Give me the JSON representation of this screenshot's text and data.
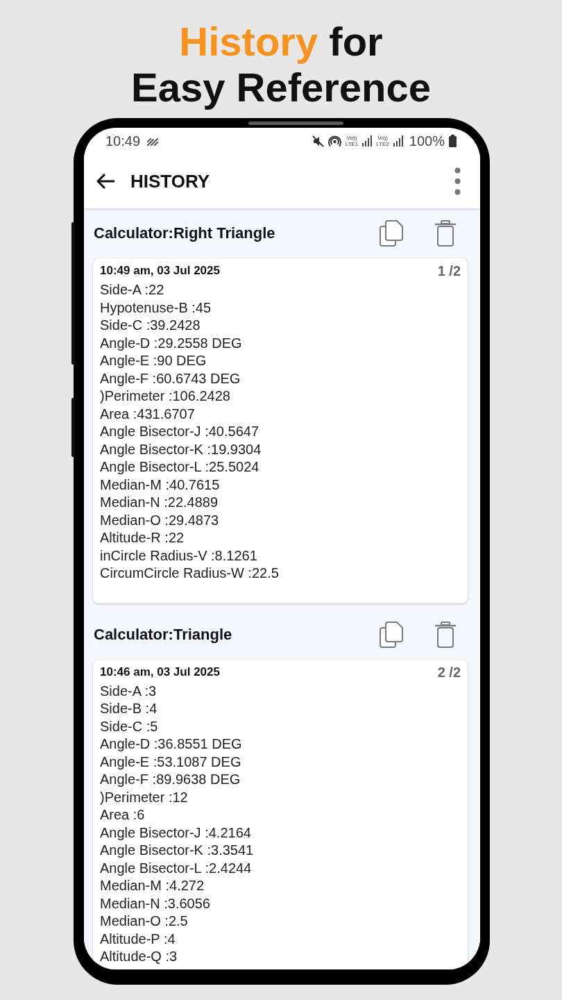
{
  "headline": {
    "lines": [
      [
        {
          "text": "History",
          "highlight": true
        },
        {
          "text": "for",
          "highlight": false
        }
      ],
      [
        {
          "text": "Easy Reference",
          "highlight": false
        }
      ]
    ]
  },
  "status_bar": {
    "time": "10:49",
    "networks": [
      {
        "voice": "Vo))",
        "label": "LTE1"
      },
      {
        "voice": "Vo))",
        "label": "LTE2"
      }
    ],
    "battery": "100%"
  },
  "app_bar": {
    "title": "HISTORY"
  },
  "records": [
    {
      "title": "Calculator:Right Triangle",
      "timestamp": "10:49 am, 03 Jul 2025",
      "position": "1 /2",
      "lines": [
        "Side-A :22",
        "Hypotenuse-B :45",
        "Side-C :39.2428",
        "Angle-D :29.2558 DEG",
        "Angle-E :90 DEG",
        "Angle-F :60.6743 DEG",
        ")Perimeter :106.2428",
        "Area :431.6707",
        "Angle Bisector-J :40.5647",
        "Angle Bisector-K :19.9304",
        "Angle Bisector-L :25.5024",
        "Median-M :40.7615",
        "Median-N :22.4889",
        "Median-O :29.4873",
        "Altitude-R :22",
        "inCircle Radius-V :8.1261",
        "CircumCircle Radius-W :22.5"
      ]
    },
    {
      "title": "Calculator:Triangle",
      "timestamp": "10:46 am, 03 Jul 2025",
      "position": "2 /2",
      "lines": [
        "Side-A :3",
        "Side-B :4",
        "Side-C :5",
        "Angle-D :36.8551 DEG",
        "Angle-E :53.1087 DEG",
        "Angle-F :89.9638 DEG",
        ")Perimeter :12",
        "Area :6",
        "Angle Bisector-J :4.2164",
        "Angle Bisector-K :3.3541",
        "Angle Bisector-L :2.4244",
        "Median-M :4.272",
        "Median-N :3.6056",
        "Median-O :2.5",
        "Altitude-P :4",
        "Altitude-Q :3"
      ]
    }
  ]
}
